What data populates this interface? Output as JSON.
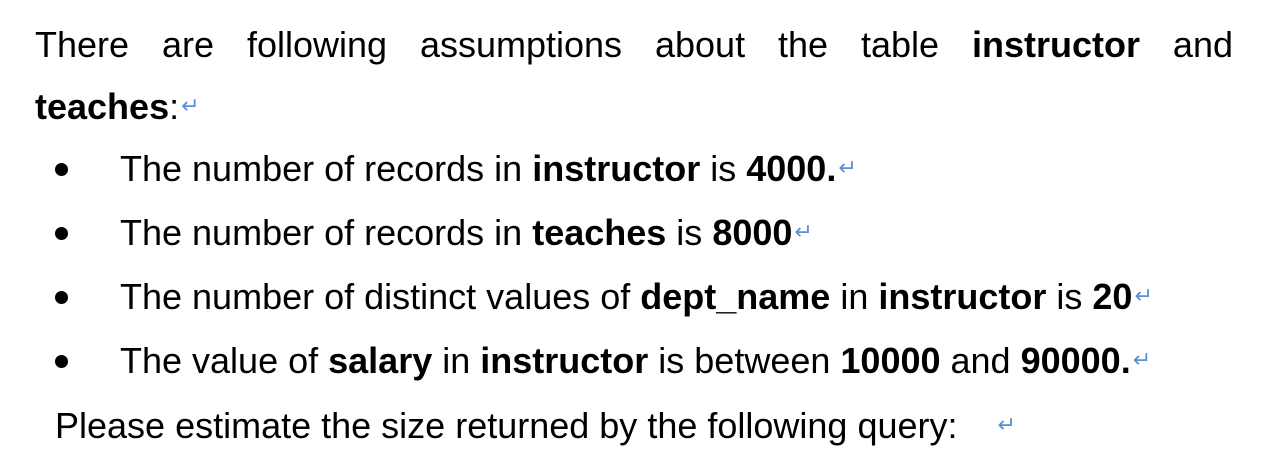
{
  "intro": {
    "line1_prefix": "There are following assumptions about the table ",
    "line1_bold": "instructor",
    "line1_suffix": " and",
    "line2_bold": "teaches",
    "line2_suffix": ":"
  },
  "bullets": [
    {
      "t1": "The number of records in ",
      "b1": "instructor",
      "t2": " is ",
      "b2": "4000.",
      "t3": "",
      "b3": "",
      "t4": "",
      "b4": ""
    },
    {
      "t1": "The number of records in ",
      "b1": "teaches",
      "t2": " is ",
      "b2": "8000",
      "t3": "",
      "b3": "",
      "t4": "",
      "b4": ""
    },
    {
      "t1": "The number of distinct values of ",
      "b1": "dept_name",
      "t2": " in ",
      "b2": "instructor",
      "t3": " is ",
      "b3": "20",
      "t4": "",
      "b4": ""
    },
    {
      "t1": "The value of ",
      "b1": "salary",
      "t2": " in ",
      "b2": "instructor",
      "t3": " is between ",
      "b3": "10000",
      "t4": " and ",
      "b4": "90000."
    }
  ],
  "closing": {
    "text": "Please estimate the size returned by the following query:"
  },
  "return_glyph": "↵",
  "colors": {
    "text": "#000000",
    "paragraph_mark": "#5b8fd6"
  }
}
